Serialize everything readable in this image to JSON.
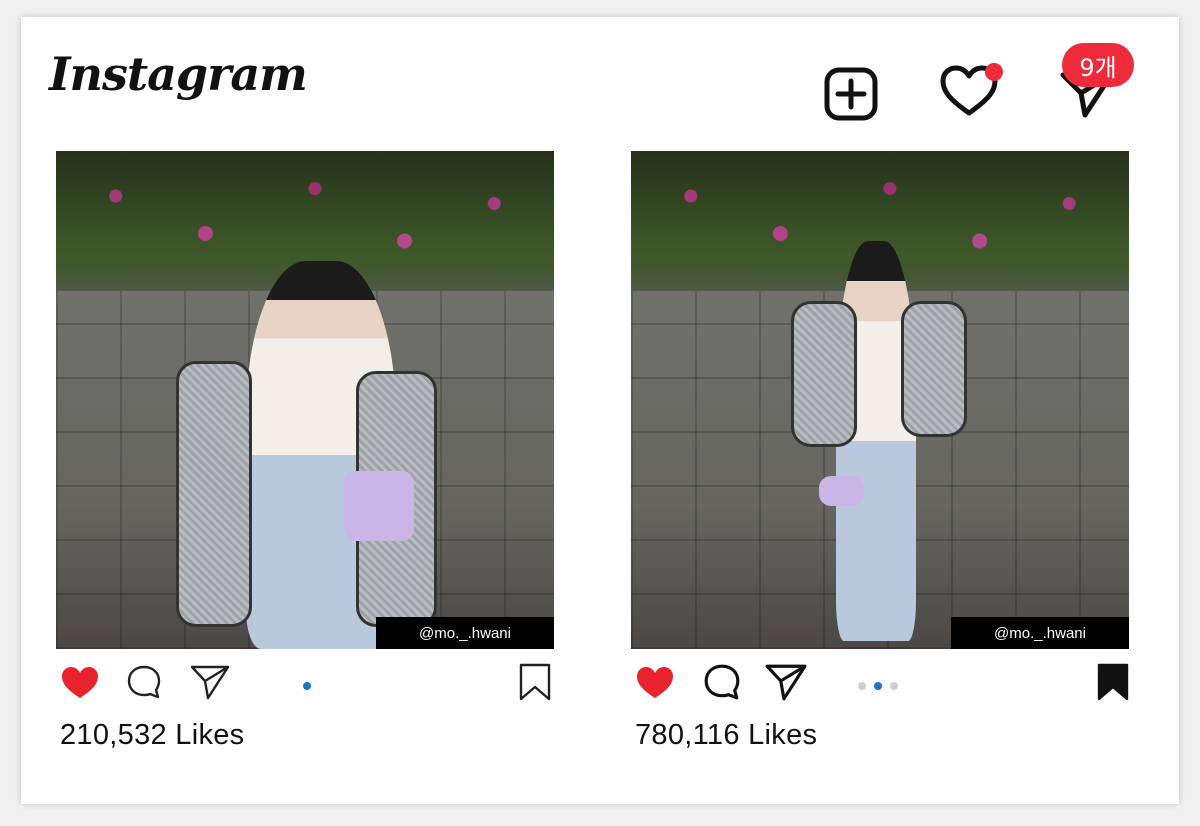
{
  "app": {
    "title": "Instagram"
  },
  "header": {
    "messages_badge": "9개",
    "icons": [
      "add-post-icon",
      "heart-icon",
      "send-icon"
    ],
    "notification_dot_color": "#ee2a3b"
  },
  "posts": [
    {
      "username_tag": "@mo._.hwani",
      "likes": "210,532 Likes",
      "liked": true,
      "saved": false,
      "carousel_dots": 1,
      "carousel_active": 0
    },
    {
      "username_tag": "@mo._.hwani",
      "likes": "780,116 Likes",
      "liked": true,
      "saved": true,
      "carousel_dots": 3,
      "carousel_active": 1
    }
  ],
  "colors": {
    "like_red": "#e8232d",
    "dot_active": "#1a73c8",
    "dot_inactive": "#cfcfcf"
  }
}
